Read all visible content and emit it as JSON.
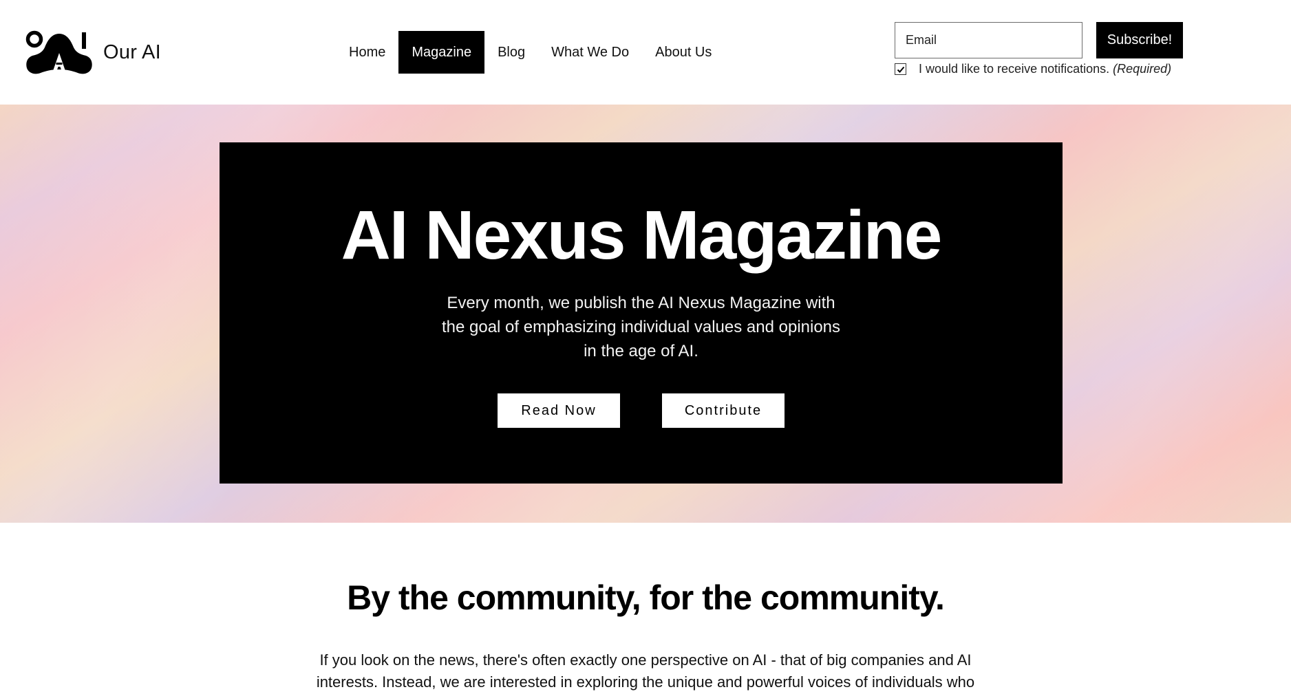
{
  "brand": {
    "logo_letters": "OAI",
    "name": "Our AI"
  },
  "nav": {
    "items": [
      {
        "label": "Home",
        "active": false
      },
      {
        "label": "Magazine",
        "active": true
      },
      {
        "label": "Blog",
        "active": false
      },
      {
        "label": "What We Do",
        "active": false
      },
      {
        "label": "About Us",
        "active": false
      }
    ]
  },
  "subscribe": {
    "email_placeholder": "Email",
    "email_value": "",
    "button_label": "Subscribe!",
    "notify_label": "I would like to receive notifications.",
    "notify_required": "(Required)",
    "notify_checked": true
  },
  "hero": {
    "title": "AI Nexus Magazine",
    "description": "Every month, we publish the AI Nexus Magazine with the goal of emphasizing individual values and opinions in the age of AI.",
    "buttons": {
      "read_now": "Read Now",
      "contribute": "Contribute"
    }
  },
  "community": {
    "title": "By the community, for the community.",
    "text": "If you look on the news, there's often exactly one perspective on AI - that of big companies and AI interests. Instead, we are interested in exploring the unique and powerful voices of individuals who"
  },
  "colors": {
    "accent": "#000000",
    "background": "#ffffff",
    "hero_gradient": [
      "#f4d6c4",
      "#e9c9db",
      "#f6c4c8",
      "#dfcde2",
      "#f9c3bd"
    ]
  },
  "icons": {
    "logo": "oai-logo-icon",
    "checkbox": "checkmark-icon"
  }
}
